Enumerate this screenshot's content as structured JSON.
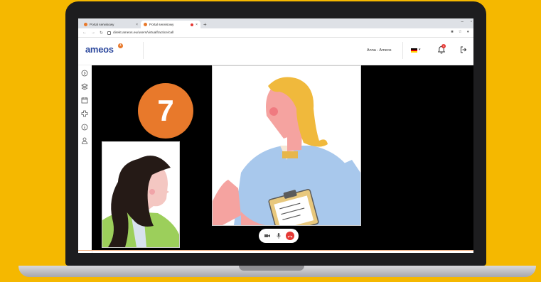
{
  "browser": {
    "tabs": [
      {
        "label": "Portal serwisowy"
      },
      {
        "label": "Portal serwisowy"
      }
    ],
    "url": "direkt.ameos.eu/users/virtualfractice/call"
  },
  "header": {
    "logo": "ameos",
    "user": "Anna - Ameos",
    "notifications": "1"
  },
  "main": {
    "step_number": "7"
  },
  "colors": {
    "background": "#f5b800",
    "accent": "#e8792b",
    "brand": "#2e4a9e",
    "end_call": "#e53935"
  }
}
